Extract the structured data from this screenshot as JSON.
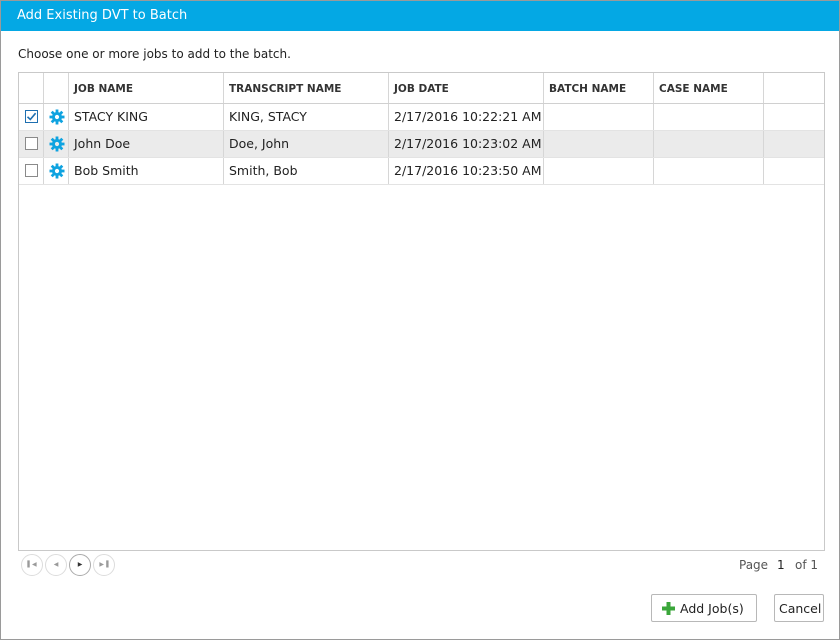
{
  "dialog": {
    "title": "Add Existing DVT to Batch",
    "instructions": "Choose one or more jobs to add to the batch."
  },
  "grid": {
    "columns": [
      "JOB NAME",
      "TRANSCRIPT NAME",
      "JOB DATE",
      "BATCH NAME",
      "CASE NAME"
    ],
    "rows": [
      {
        "checked": true,
        "job_name": "STACY KING",
        "transcript_name": "KING, STACY",
        "job_date": "2/17/2016 10:22:21 AM",
        "batch_name": "",
        "case_name": ""
      },
      {
        "checked": false,
        "job_name": "John Doe",
        "transcript_name": "Doe, John",
        "job_date": "2/17/2016 10:23:02 AM",
        "batch_name": "",
        "case_name": ""
      },
      {
        "checked": false,
        "job_name": "Bob Smith",
        "transcript_name": "Smith, Bob",
        "job_date": "2/17/2016 10:23:50 AM",
        "batch_name": "",
        "case_name": ""
      }
    ]
  },
  "pager": {
    "page_label": "Page",
    "current_page": "1",
    "of_label": "of 1"
  },
  "buttons": {
    "add_jobs": "Add Job(s)",
    "cancel": "Cancel"
  },
  "icons": {
    "row_settings": "gear-icon",
    "add": "plus-icon",
    "pager_first": "first-page-icon",
    "pager_prev": "prev-page-icon",
    "pager_next": "next-page-icon",
    "pager_last": "last-page-icon"
  },
  "colors": {
    "titlebar": "#04a8e4",
    "gear": "#0fa3e0",
    "add_icon": "#3aa63a",
    "alt_row": "#ebebeb"
  }
}
